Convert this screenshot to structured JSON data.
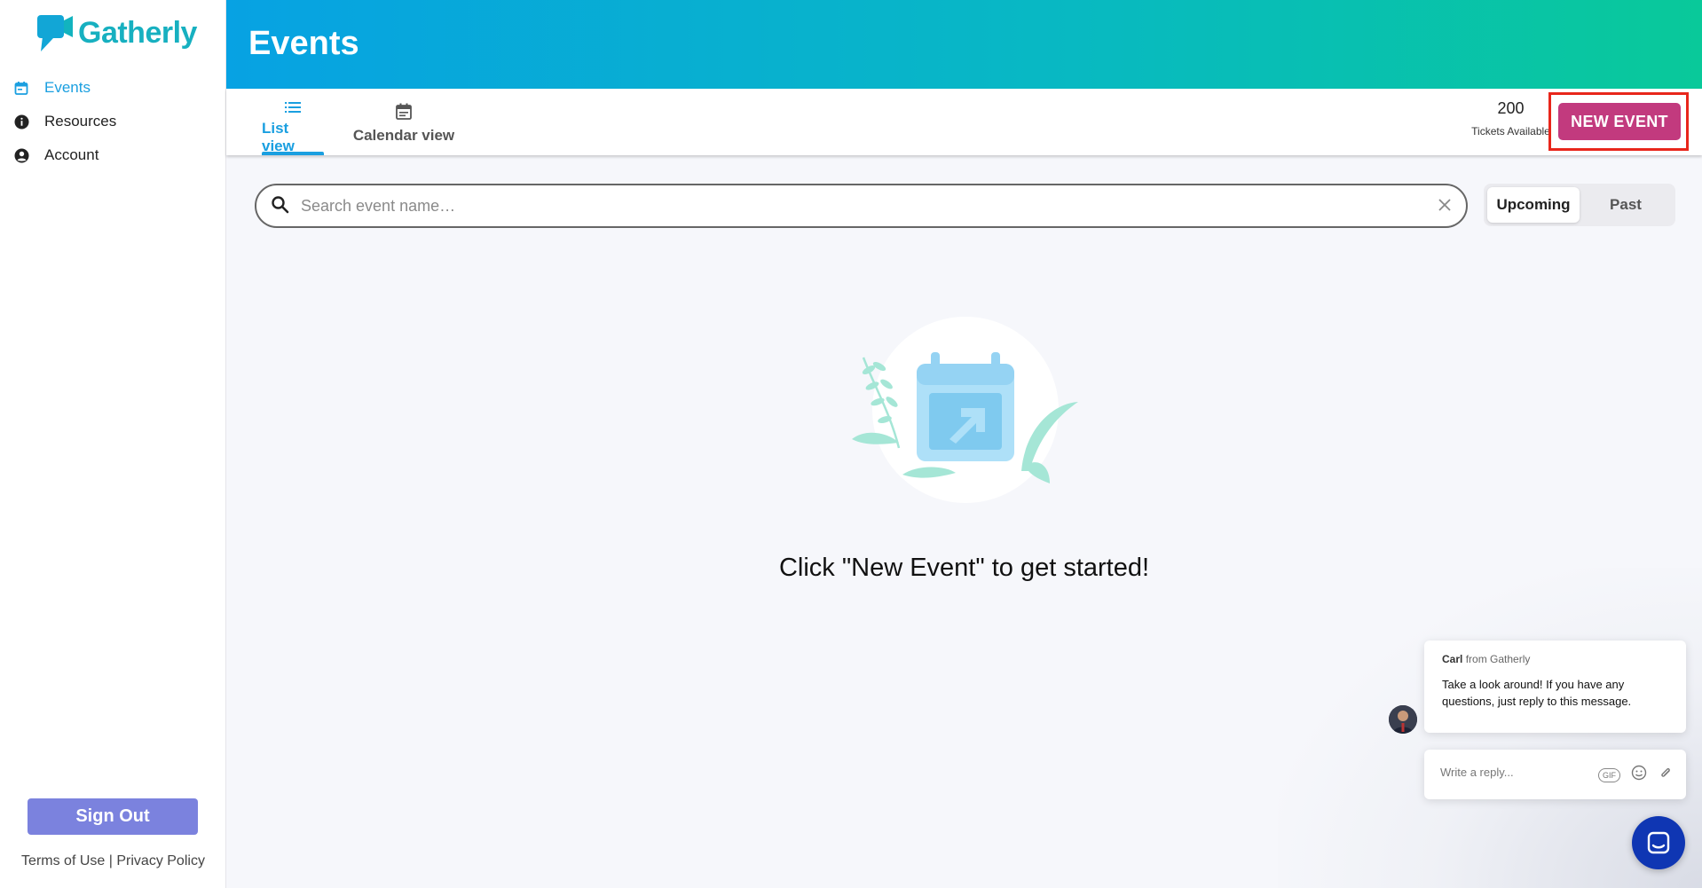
{
  "app": {
    "name": "Gatherly"
  },
  "sidebar": {
    "items": [
      {
        "label": "Events",
        "icon": "calendar-icon",
        "active": true
      },
      {
        "label": "Resources",
        "icon": "info-icon",
        "active": false
      },
      {
        "label": "Account",
        "icon": "account-circle-icon",
        "active": false
      }
    ],
    "sign_out_label": "Sign Out",
    "terms_label": "Terms of Use",
    "separator": "|",
    "privacy_label": "Privacy Policy"
  },
  "header": {
    "title": "Events"
  },
  "toolbar": {
    "tabs": [
      {
        "label": "List view",
        "icon": "list-icon",
        "active": true
      },
      {
        "label": "Calendar view",
        "icon": "calendar-icon",
        "active": false
      }
    ],
    "tickets_count": "200",
    "tickets_label": "Tickets Available",
    "new_event_label": "NEW EVENT"
  },
  "search": {
    "placeholder": "Search event name…",
    "value": ""
  },
  "filter": {
    "options": [
      "Upcoming",
      "Past"
    ],
    "selected": "Upcoming"
  },
  "empty_state": {
    "message": "Click \"New Event\" to get started!"
  },
  "chat": {
    "sender_name": "Carl",
    "sender_suffix": "from Gatherly",
    "message": "Take a look around! If you have any questions, just reply to this message.",
    "reply_placeholder": "Write a reply...",
    "gif_label": "GIF"
  },
  "colors": {
    "accent": "#1a9fe0",
    "new_event": "#c23a7e",
    "sign_out": "#7b82de",
    "header_start": "#07a2e3",
    "header_end": "#09c99a",
    "highlight": "#e8261b",
    "launcher": "#0f36b3"
  }
}
